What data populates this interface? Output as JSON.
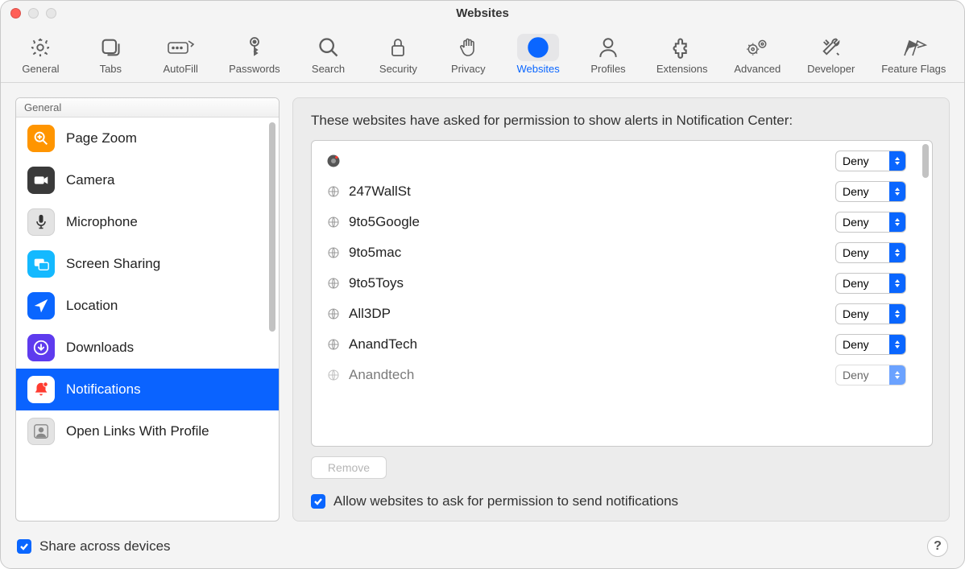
{
  "window": {
    "title": "Websites"
  },
  "toolbar": [
    {
      "id": "general",
      "label": "General"
    },
    {
      "id": "tabs",
      "label": "Tabs"
    },
    {
      "id": "autofill",
      "label": "AutoFill"
    },
    {
      "id": "passwords",
      "label": "Passwords"
    },
    {
      "id": "search",
      "label": "Search"
    },
    {
      "id": "security",
      "label": "Security"
    },
    {
      "id": "privacy",
      "label": "Privacy"
    },
    {
      "id": "websites",
      "label": "Websites",
      "selected": true
    },
    {
      "id": "profiles",
      "label": "Profiles"
    },
    {
      "id": "extensions",
      "label": "Extensions"
    },
    {
      "id": "advanced",
      "label": "Advanced"
    },
    {
      "id": "developer",
      "label": "Developer"
    },
    {
      "id": "featureflags",
      "label": "Feature Flags"
    }
  ],
  "sidebar": {
    "section_label": "General",
    "items": [
      {
        "id": "page-zoom",
        "label": "Page Zoom",
        "icon": "zoom",
        "color": "#ff9500"
      },
      {
        "id": "camera",
        "label": "Camera",
        "icon": "camera",
        "color": "#3a3a3a"
      },
      {
        "id": "microphone",
        "label": "Microphone",
        "icon": "mic",
        "color": "#dcdcdc"
      },
      {
        "id": "screen-sharing",
        "label": "Screen Sharing",
        "icon": "screens",
        "color": "#00b7ff"
      },
      {
        "id": "location",
        "label": "Location",
        "icon": "arrow",
        "color": "#0a66ff"
      },
      {
        "id": "downloads",
        "label": "Downloads",
        "icon": "download",
        "color": "#5e3bee"
      },
      {
        "id": "notifications",
        "label": "Notifications",
        "icon": "bell",
        "color": "#ff3b30",
        "selected": true
      },
      {
        "id": "open-links",
        "label": "Open Links With Profile",
        "icon": "profile",
        "color": "#cfcfcf"
      }
    ]
  },
  "main": {
    "heading": "These websites have asked for permission to show alerts in Notification Center:",
    "sites": [
      {
        "name": "",
        "permission": "Deny",
        "special_icon": true
      },
      {
        "name": "247WallSt",
        "permission": "Deny"
      },
      {
        "name": "9to5Google",
        "permission": "Deny"
      },
      {
        "name": "9to5mac",
        "permission": "Deny"
      },
      {
        "name": "9to5Toys",
        "permission": "Deny"
      },
      {
        "name": "All3DP",
        "permission": "Deny"
      },
      {
        "name": "AnandTech",
        "permission": "Deny"
      },
      {
        "name": "Anandtech",
        "permission": "Deny"
      }
    ],
    "remove_label": "Remove",
    "allow_checkbox_label": "Allow websites to ask for permission to send notifications",
    "allow_checked": true
  },
  "footer": {
    "share_label": "Share across devices",
    "share_checked": true,
    "help_label": "?"
  }
}
